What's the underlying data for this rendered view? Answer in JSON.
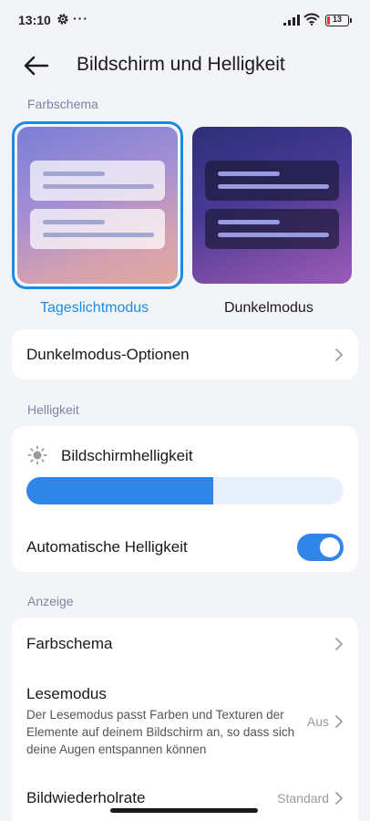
{
  "status_bar": {
    "time": "13:10",
    "dots": "···",
    "battery": "13",
    "battery_color": "#e53935"
  },
  "header": {
    "title": "Bildschirm und Helligkeit",
    "back_icon": "arrow-left-icon"
  },
  "color_scheme_section": {
    "label": "Farbschema",
    "options": [
      {
        "label": "Tageslichtmodus",
        "selected": true
      },
      {
        "label": "Dunkelmodus",
        "selected": false
      }
    ],
    "accent": "#1e8ae8"
  },
  "dark_mode_options": {
    "label": "Dunkelmodus-Optionen"
  },
  "brightness_section": {
    "label": "Helligkeit",
    "screen_brightness_label": "Bildschirmhelligkeit",
    "brightness_level": 0.59,
    "auto_brightness_label": "Automatische Helligkeit",
    "auto_brightness_on": true
  },
  "display_section": {
    "label": "Anzeige",
    "color_scheme_label": "Farbschema",
    "reading_mode": {
      "title": "Lesemodus",
      "description": "Der Lesemodus passt Farben und Texturen der Elemente auf deinem Bildschirm an, so dass sich deine Augen entspannen können",
      "value": "Aus"
    },
    "refresh_rate": {
      "title": "Bildwiederholrate",
      "value": "Standard"
    }
  }
}
